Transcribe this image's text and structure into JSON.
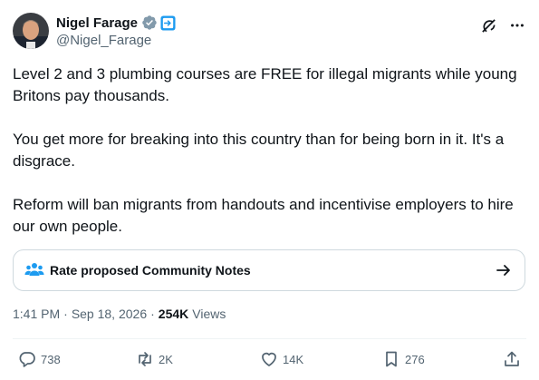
{
  "author": {
    "display_name": "Nigel Farage",
    "handle": "@Nigel_Farage"
  },
  "tweet": {
    "text": "Level 2 and 3 plumbing courses are FREE for illegal migrants while young Britons pay thousands.\n\nYou get more for breaking into this country than for being born in it. It's a disgrace.\n\nReform will ban migrants from handouts and incentivise employers to hire our own people."
  },
  "community_notes": {
    "label": "Rate proposed Community Notes"
  },
  "meta": {
    "time": "1:41 PM",
    "separator": "·",
    "date": "Sep 18, 2026",
    "separator2": "·",
    "views_count": "254K",
    "views_label": "Views"
  },
  "actions": {
    "replies": "738",
    "reposts": "2K",
    "likes": "14K",
    "bookmarks": "276"
  },
  "colors": {
    "verified_badge": "#829aab",
    "text": "#0f1419",
    "muted": "#536471",
    "notes_icon": "#1d9bf0",
    "automated_badge": "#1d9bf0"
  },
  "icons": {
    "verified": "verified-badge-icon",
    "automated": "automated-label-icon",
    "grok": "grok-icon",
    "more": "more-icon",
    "notes": "community-notes-icon",
    "arrow": "arrow-right-icon",
    "reply": "reply-icon",
    "repost": "repost-icon",
    "like": "heart-icon",
    "bookmark": "bookmark-icon",
    "share": "share-icon"
  }
}
